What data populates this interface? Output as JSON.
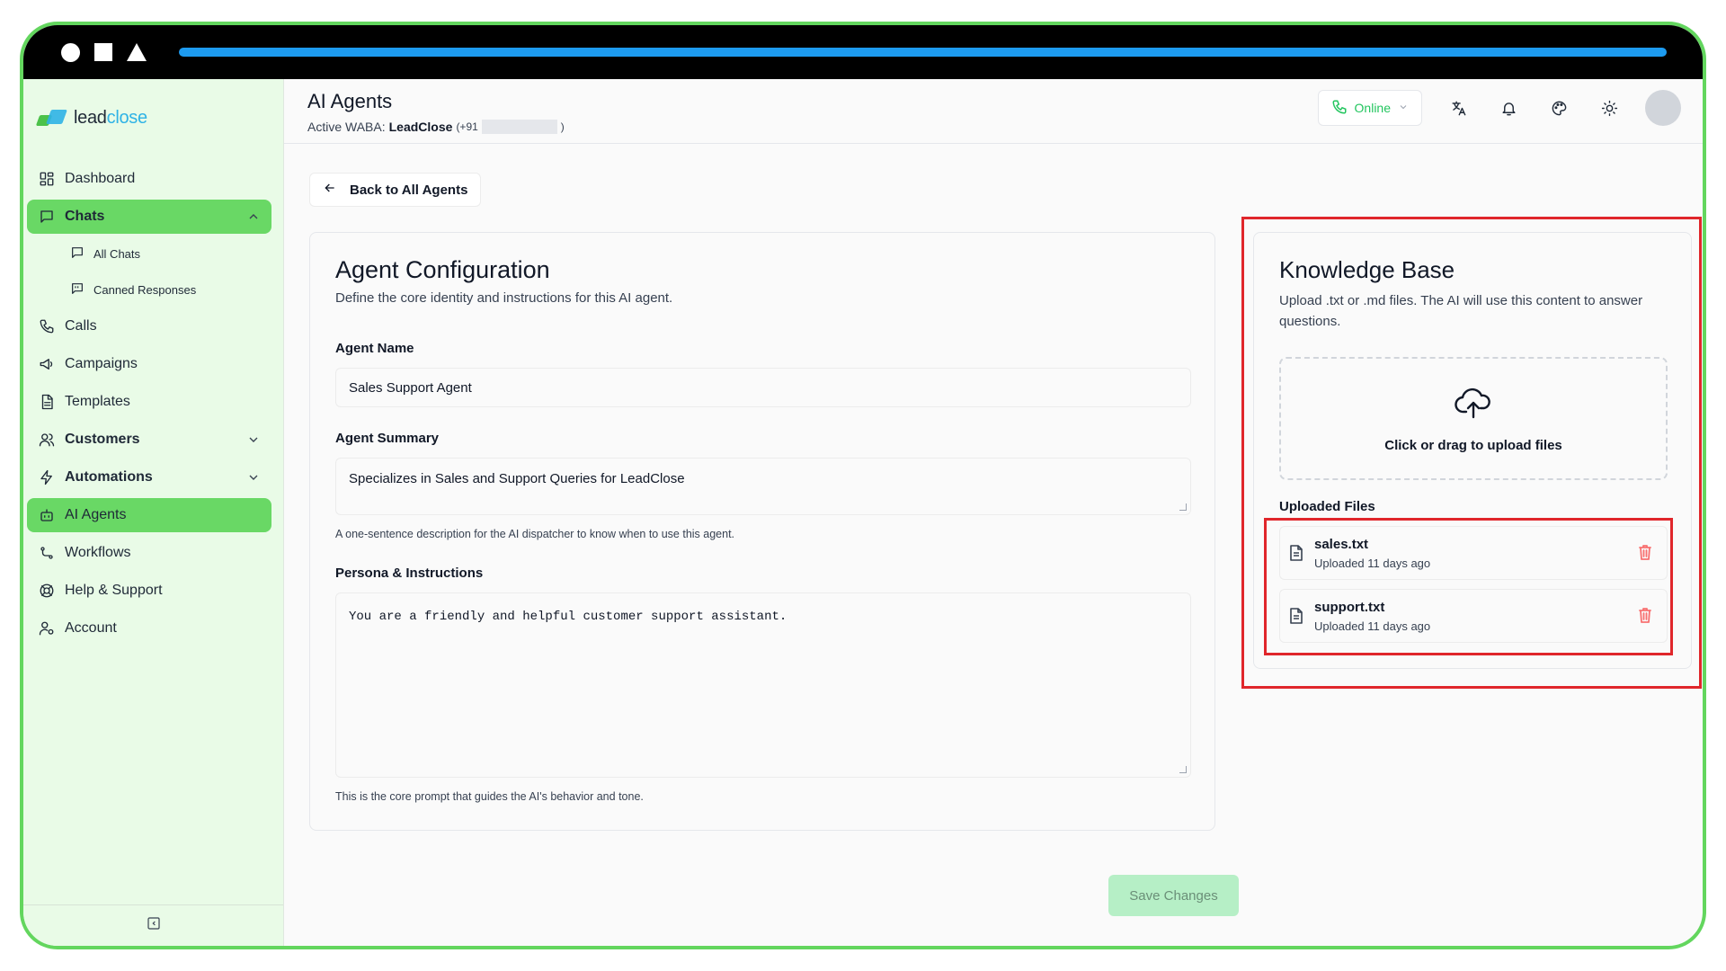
{
  "brand": {
    "name_prefix": "lead",
    "name_suffix": "close",
    "accent": "#2fb3e6",
    "green": "#69d865"
  },
  "sidebar": {
    "items": [
      {
        "label": "Dashboard",
        "icon": "dashboard-grid-icon"
      },
      {
        "label": "Chats",
        "icon": "chat-bubble-icon",
        "active": true,
        "expanded": true
      },
      {
        "label": "Calls",
        "icon": "phone-icon"
      },
      {
        "label": "Campaigns",
        "icon": "megaphone-icon"
      },
      {
        "label": "Templates",
        "icon": "document-icon"
      },
      {
        "label": "Customers",
        "icon": "users-icon"
      },
      {
        "label": "Automations",
        "icon": "lightning-icon"
      },
      {
        "label": "AI Agents",
        "icon": "robot-icon",
        "active": true
      },
      {
        "label": "Workflows",
        "icon": "workflow-icon"
      },
      {
        "label": "Help & Support",
        "icon": "lifebuoy-icon"
      },
      {
        "label": "Account",
        "icon": "user-cog-icon"
      }
    ],
    "chats_sub": [
      {
        "label": "All Chats",
        "icon": "chat-square-icon"
      },
      {
        "label": "Canned Responses",
        "icon": "chat-quote-icon"
      }
    ]
  },
  "header": {
    "title": "AI Agents",
    "waba_label": "Active WABA:",
    "waba_name": "LeadClose",
    "waba_phone_prefix": "(+91",
    "waba_phone_suffix": ")",
    "status": "Online",
    "status_color": "#22c55e"
  },
  "back_button": {
    "label": "Back to All Agents"
  },
  "config": {
    "title": "Agent Configuration",
    "subtitle": "Define the core identity and instructions for this AI agent.",
    "agent_name_label": "Agent Name",
    "agent_name_value": "Sales Support Agent",
    "summary_label": "Agent Summary",
    "summary_value": "Specializes in Sales and Support Queries for LeadClose",
    "summary_help": "A one-sentence description for the AI dispatcher to know when to use this agent.",
    "persona_label": "Persona & Instructions",
    "persona_value": "You are a friendly and helpful customer support assistant.",
    "persona_help": "This is the core prompt that guides the AI's behavior and tone."
  },
  "save_button": {
    "label": "Save Changes"
  },
  "knowledge_base": {
    "title": "Knowledge Base",
    "subtitle": "Upload .txt or .md files. The AI will use this content to answer questions.",
    "dropzone_text": "Click or drag to upload files",
    "uploaded_label": "Uploaded Files",
    "files": [
      {
        "name": "sales.txt",
        "meta": "Uploaded 11 days ago"
      },
      {
        "name": "support.txt",
        "meta": "Uploaded 11 days ago"
      }
    ]
  },
  "highlight_color": "#e0262b"
}
